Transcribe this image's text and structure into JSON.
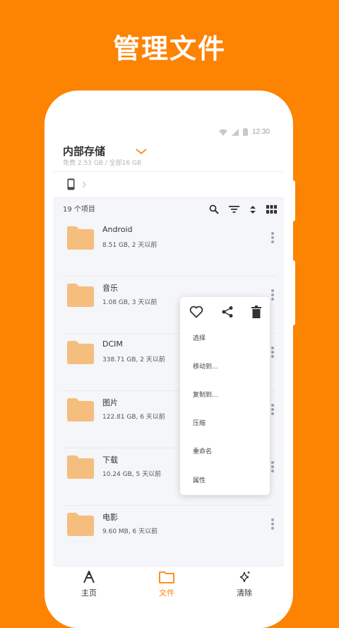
{
  "headline": "管理文件",
  "status": {
    "time": "12:30"
  },
  "storage": {
    "title": "内部存储",
    "subtitle": "免费 2.53 GB / 全部16 GB"
  },
  "toolbar": {
    "count": "19 个项目"
  },
  "files": [
    {
      "name": "Android",
      "meta": "8.51 GB, 2 天以前"
    },
    {
      "name": "音乐",
      "meta": "1.08 GB, 3 天以前"
    },
    {
      "name": "DCIM",
      "meta": "338.71 GB, 2 天以前"
    },
    {
      "name": "图片",
      "meta": "122.81 GB, 6 天以前"
    },
    {
      "name": "下载",
      "meta": "10.24 GB, 5 天以前"
    },
    {
      "name": "电影",
      "meta": "9.60 MB, 6 天以前"
    }
  ],
  "menu": {
    "items": [
      "选择",
      "移动到...",
      "复制到...",
      "压缩",
      "重命名",
      "属性"
    ]
  },
  "nav": {
    "home": "主页",
    "files": "文件",
    "clean": "清除"
  },
  "colors": {
    "accent": "#fd8303",
    "folder": "#f5be7e",
    "background": "#f5f6fa"
  }
}
